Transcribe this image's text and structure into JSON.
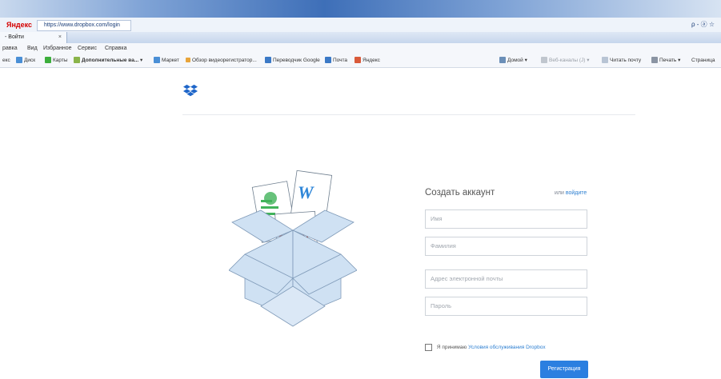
{
  "browser": {
    "brand": "Яндекс",
    "url": "https://www.dropbox.com/login",
    "right_controls": "ρ - ⓐ ☆",
    "tab_title": "- Войти",
    "menu": [
      "равка",
      "Вид",
      "Избранное",
      "Сервис",
      "Справка"
    ],
    "favorites": [
      "екс",
      "Диск",
      "Карты",
      "Дополнительные ва...",
      "Маркет",
      "Обзор видеорегистратор...",
      "Переводчик Google",
      "Почта",
      "Яндекс"
    ],
    "toolbar_right": [
      "Домой",
      "Веб-каналы (J)",
      "Читать почту",
      "Печать",
      "Страница"
    ]
  },
  "signup": {
    "title": "Создать аккаунт",
    "alt_prefix": "или",
    "alt_link": "войдите",
    "first_name_placeholder": "Имя",
    "last_name_placeholder": "Фамилия",
    "email_placeholder": "Адрес электронной почты",
    "password_placeholder": "Пароль",
    "terms_prefix": "Я принимаю",
    "terms_link": "Условия обслуживания Dropbox",
    "submit": "Регистрация"
  },
  "colors": {
    "accent": "#2b7fe0",
    "link": "#2d7fd1",
    "box": "#cfe1f3"
  },
  "icons": [
    "dropbox-logo-icon",
    "dropbox-open-box-illustration"
  ]
}
